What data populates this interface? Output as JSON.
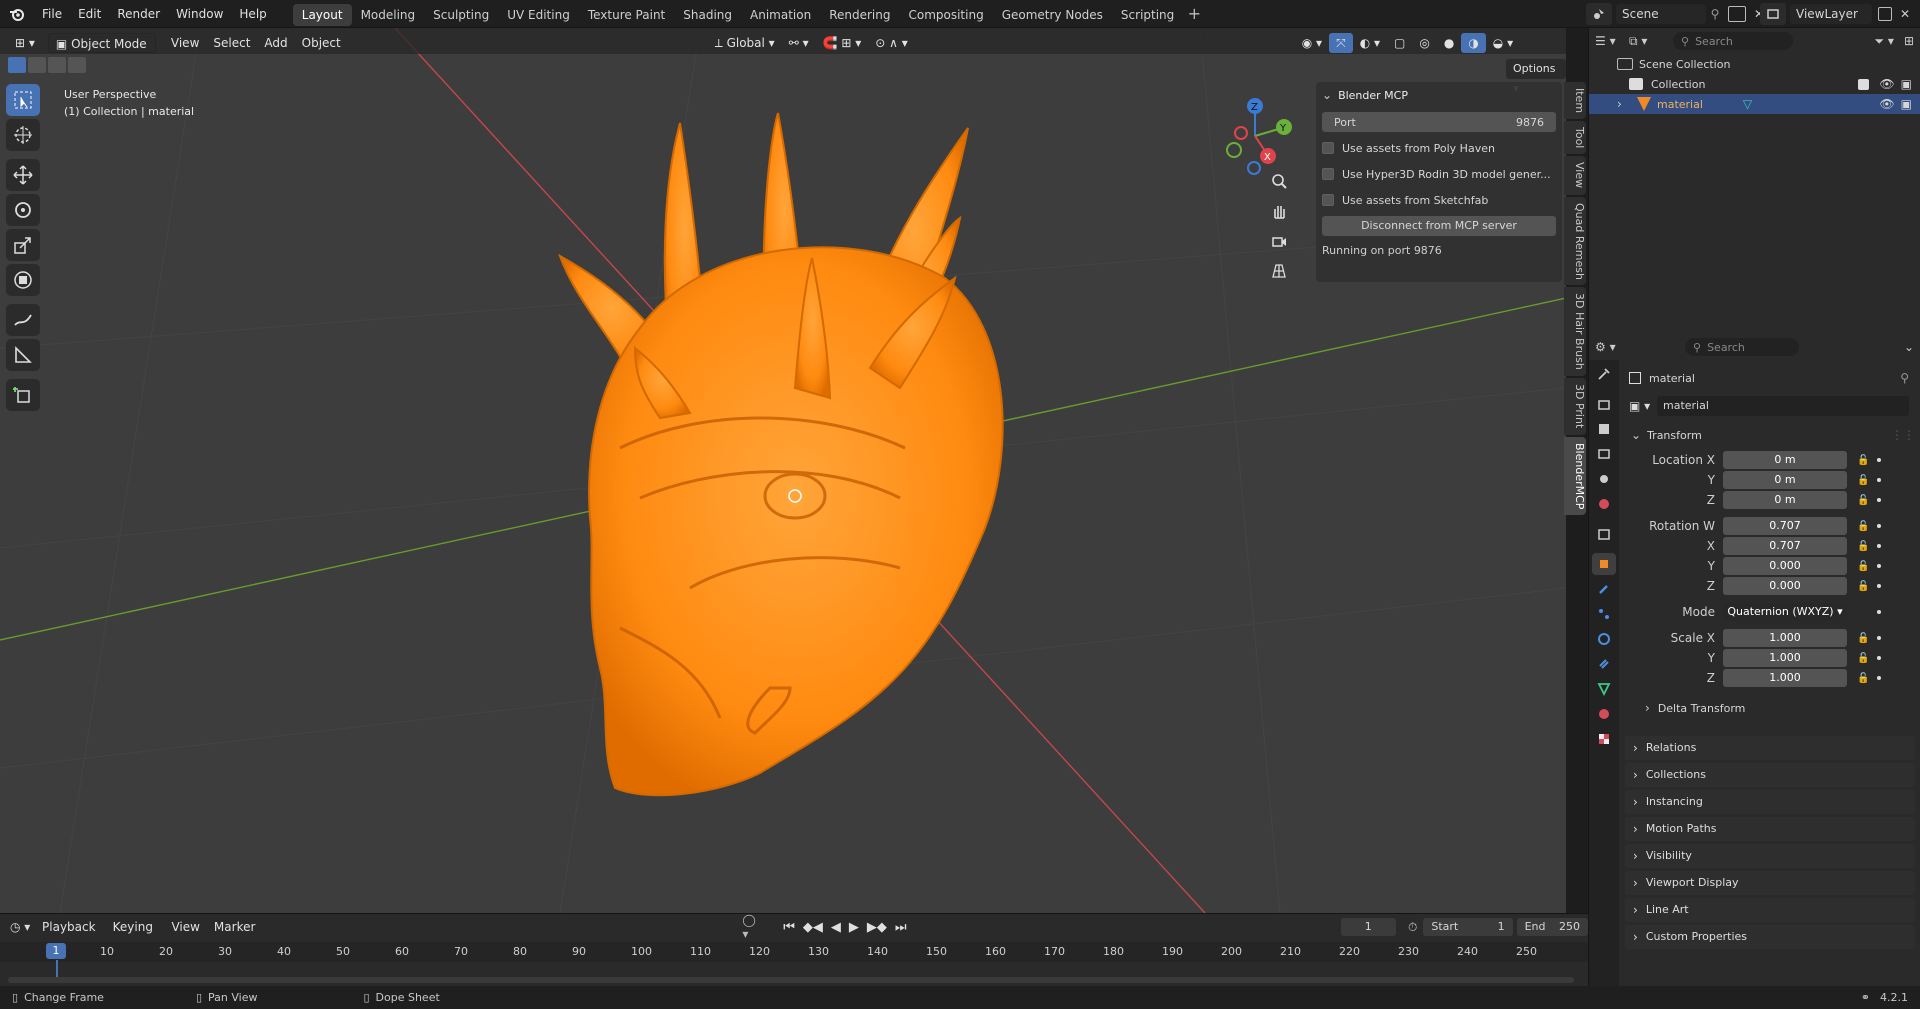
{
  "topbar": {
    "menus": [
      "File",
      "Edit",
      "Render",
      "Window",
      "Help"
    ],
    "workspaces": [
      "Layout",
      "Modeling",
      "Sculpting",
      "UV Editing",
      "Texture Paint",
      "Shading",
      "Animation",
      "Rendering",
      "Compositing",
      "Geometry Nodes",
      "Scripting"
    ],
    "active_workspace": "Layout",
    "scene": "Scene",
    "view_layer": "ViewLayer"
  },
  "viewport": {
    "mode": "Object Mode",
    "menus": [
      "View",
      "Select",
      "Add",
      "Object"
    ],
    "transform_orientation": "Global",
    "options_label": "Options",
    "overlay_line1": "User Perspective",
    "overlay_line2": "(1) Collection | material",
    "object_color": "#ff8a10"
  },
  "npanel": {
    "title": "Blender MCP",
    "port_label": "Port",
    "port_value": "9876",
    "checkboxes": [
      "Use assets from Poly Haven",
      "Use Hyper3D Rodin 3D model gener...",
      "Use assets from Sketchfab"
    ],
    "disconnect_label": "Disconnect from MCP server",
    "status": "Running on port 9876",
    "tabs": [
      "Item",
      "Tool",
      "View",
      "Quad Remesh",
      "3D Hair Brush",
      "3D Print",
      "BlenderMCP"
    ],
    "active_tab": "BlenderMCP"
  },
  "timeline": {
    "menus": [
      "Playback",
      "Keying",
      "View",
      "Marker"
    ],
    "current_frame": "1",
    "start_label": "Start",
    "start_value": "1",
    "end_label": "End",
    "end_value": "250",
    "ruler": [
      "10",
      "20",
      "30",
      "40",
      "50",
      "60",
      "70",
      "80",
      "90",
      "100",
      "110",
      "120",
      "130",
      "140",
      "150",
      "160",
      "170",
      "180",
      "190",
      "200",
      "210",
      "220",
      "230",
      "240",
      "250"
    ],
    "playhead": "1"
  },
  "statusbar": {
    "items": [
      "Change Frame",
      "Pan View",
      "Dope Sheet"
    ],
    "version": "4.2.1"
  },
  "outliner": {
    "search_placeholder": "Search",
    "scene_collection": "Scene Collection",
    "collection": "Collection",
    "object": "material"
  },
  "properties": {
    "search_placeholder": "Search",
    "object_name": "material",
    "data_name": "material",
    "transform_title": "Transform",
    "location_label": "Location X",
    "location": [
      "0 m",
      "0 m",
      "0 m"
    ],
    "rotation_label": "Rotation W",
    "rotation": [
      "0.707",
      "0.707",
      "0.000",
      "0.000"
    ],
    "mode_label": "Mode",
    "mode_value": "Quaternion (WXYZ)",
    "scale_label": "Scale X",
    "scale": [
      "1.000",
      "1.000",
      "1.000"
    ],
    "axis_labels": [
      "Y",
      "Z",
      "X"
    ],
    "delta": "Delta Transform",
    "sections": [
      "Relations",
      "Collections",
      "Instancing",
      "Motion Paths",
      "Visibility",
      "Viewport Display",
      "Line Art",
      "Custom Properties"
    ]
  }
}
